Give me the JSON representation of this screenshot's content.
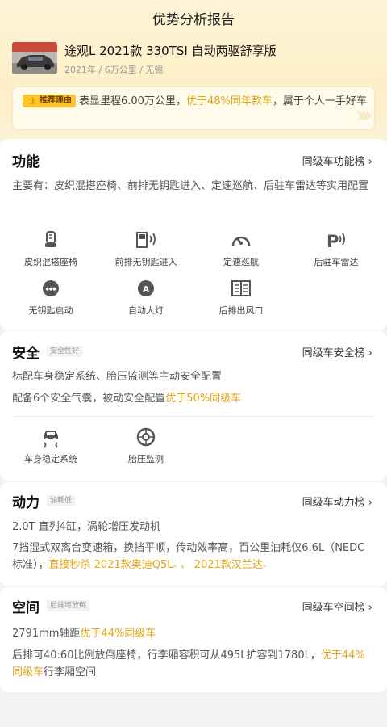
{
  "page_title": "优势分析报告",
  "car": {
    "name": "途观L 2021款 330TSI 自动两驱舒享版",
    "meta": "2021年 / 6万公里 / 无锡"
  },
  "recommend": {
    "tag": "推荐理由",
    "text_a": "表显里程6.00万公里，",
    "text_hl": "优于48%同年款车",
    "text_b": "，属于个人一手好车"
  },
  "sections": {
    "function": {
      "title": "功能",
      "rank": "同级车功能榜 ›",
      "desc": "主要有：皮织混搭座椅、前排无钥匙进入、定速巡航、后驻车雷达等实用配置",
      "features": [
        {
          "label": "皮织混搭座椅",
          "icon": "seat-icon"
        },
        {
          "label": "前排无钥匙进入",
          "icon": "door-key-icon"
        },
        {
          "label": "定速巡航",
          "icon": "speedometer-icon"
        },
        {
          "label": "后驻车雷达",
          "icon": "parking-radar-icon"
        },
        {
          "label": "无钥匙启动",
          "icon": "start-button-icon"
        },
        {
          "label": "自动大灯",
          "icon": "auto-headlight-icon"
        },
        {
          "label": "后排出风口",
          "icon": "rear-vent-icon"
        }
      ]
    },
    "safety": {
      "title": "安全",
      "tag": "安全性好",
      "rank": "同级车安全榜 ›",
      "line1": "标配车身稳定系统、胎压监测等主动安全配置",
      "line2_a": "配备6个安全气囊，被动安全配置",
      "line2_hl": "优于50%同级车",
      "features": [
        {
          "label": "车身稳定系统",
          "icon": "stability-icon"
        },
        {
          "label": "胎压监测",
          "icon": "tire-pressure-icon"
        }
      ]
    },
    "power": {
      "title": "动力",
      "tag": "油耗低",
      "rank": "同级车动力榜 ›",
      "line1": "2.0T 直列4缸，涡轮增压发动机",
      "line2": "7挡湿式双离合变速箱，换挡平顺，传动效率高，百公里油耗仅6.6L（NEDC标准），",
      "line2_hl1": "直接秒杀 2021款奥迪Q5L",
      "line2_sep": " 、 ",
      "line2_hl2": "2021款汉兰达"
    },
    "space": {
      "title": "空间",
      "tag": "后排可放倒",
      "rank": "同级车空间榜 ›",
      "line1_a": "2791mm轴距",
      "line1_hl": "优于44%同级车",
      "line2_a": "后排可40:60比例放倒座椅，行李厢容积可从495L扩容到1780L，",
      "line2_hl": "优于44%同级车",
      "line2_b": "行李厢空间"
    }
  },
  "colors": {
    "accent": "#e4a512",
    "hero_bg": "#fdf0c8",
    "tag_bg": "#ffc42c"
  }
}
